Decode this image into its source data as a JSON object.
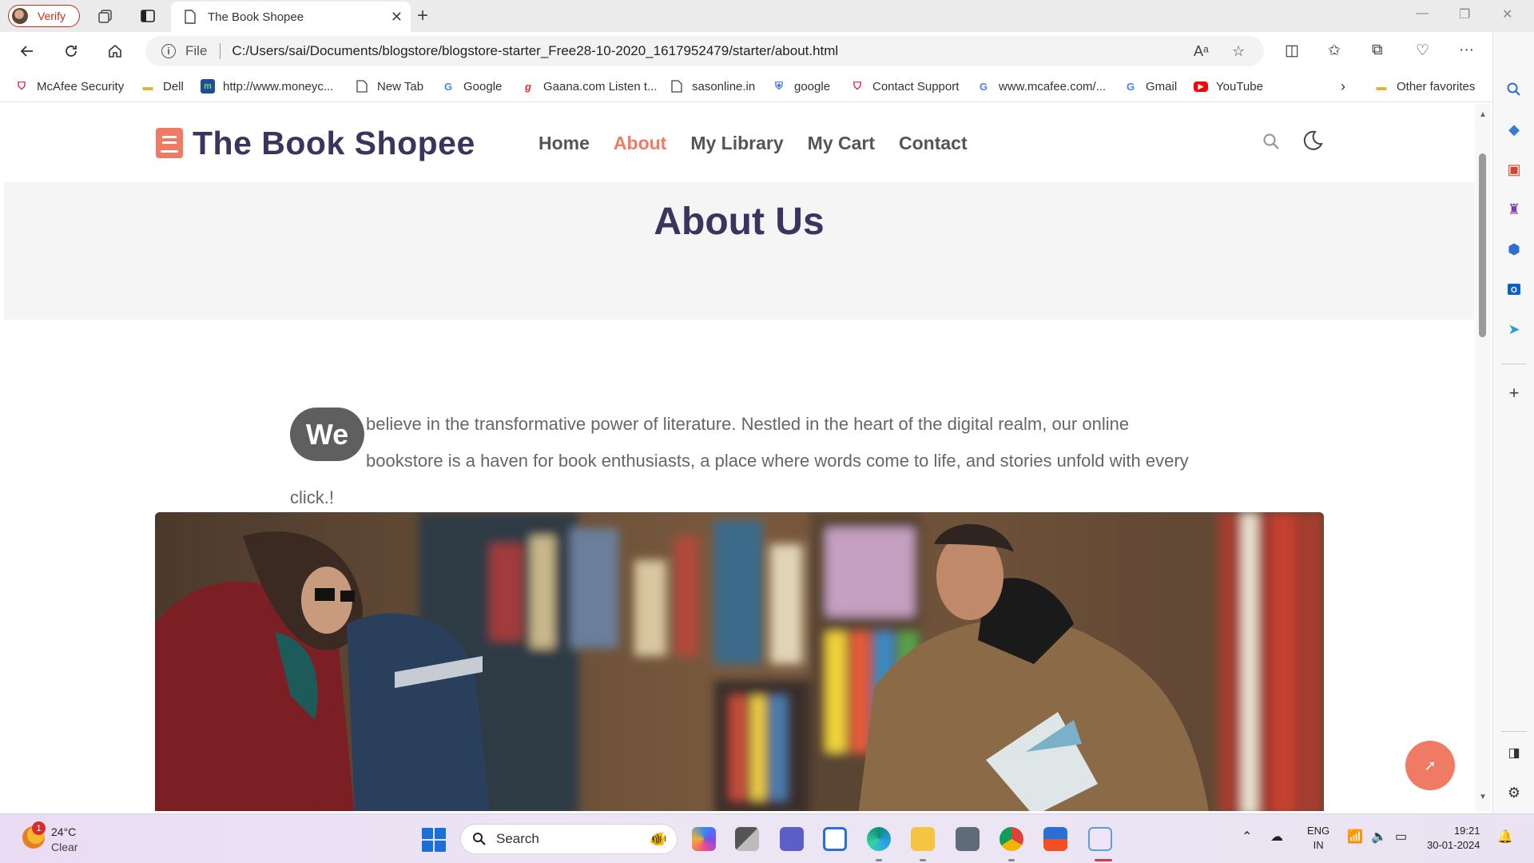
{
  "browser": {
    "profile_label": "Verify",
    "tab_title": "The Book Shopee",
    "url_scheme": "File",
    "url": "C:/Users/sai/Documents/blogstore/blogstore-starter_Free28-10-2020_1617952479/starter/about.html",
    "bookmarks": [
      {
        "label": "McAfee Security",
        "icon": "mcafee-icon"
      },
      {
        "label": "Dell",
        "icon": "folder-icon"
      },
      {
        "label": "http://www.moneyc...",
        "icon": "moneycontrol-icon"
      },
      {
        "label": "New Tab",
        "icon": "page-icon"
      },
      {
        "label": "Google",
        "icon": "google-icon"
      },
      {
        "label": "Gaana.com Listen t...",
        "icon": "gaana-icon"
      },
      {
        "label": "sasonline.in",
        "icon": "page-icon"
      },
      {
        "label": "google",
        "icon": "shield-icon"
      },
      {
        "label": "Contact Support",
        "icon": "mcafee-icon"
      },
      {
        "label": "www.mcafee.com/...",
        "icon": "google-icon"
      },
      {
        "label": "Gmail",
        "icon": "google-icon"
      },
      {
        "label": "YouTube",
        "icon": "youtube-icon"
      }
    ],
    "other_favorites": "Other favorites"
  },
  "site": {
    "logo_text": "The Book Shopee",
    "nav": [
      {
        "label": "Home",
        "active": false
      },
      {
        "label": "About",
        "active": true
      },
      {
        "label": "My Library",
        "active": false
      },
      {
        "label": "My Cart",
        "active": false
      },
      {
        "label": "Contact",
        "active": false
      }
    ],
    "banner_title": "About Us",
    "intro_dropcap": "We",
    "intro_text": " believe in the transformative power of literature. Nestled in the heart of the digital realm, our online bookstore is a haven for book enthusiasts, a place where words come to life, and stories unfold with every click.!",
    "accent_color": "#f07b65",
    "heading_color": "#3a355f"
  },
  "taskbar": {
    "weather_temp": "24°C",
    "weather_condition": "Clear",
    "weather_badge": "1",
    "search_label": "Search",
    "lang_line1": "ENG",
    "lang_line2": "IN",
    "time": "19:21",
    "date": "30-01-2024"
  }
}
